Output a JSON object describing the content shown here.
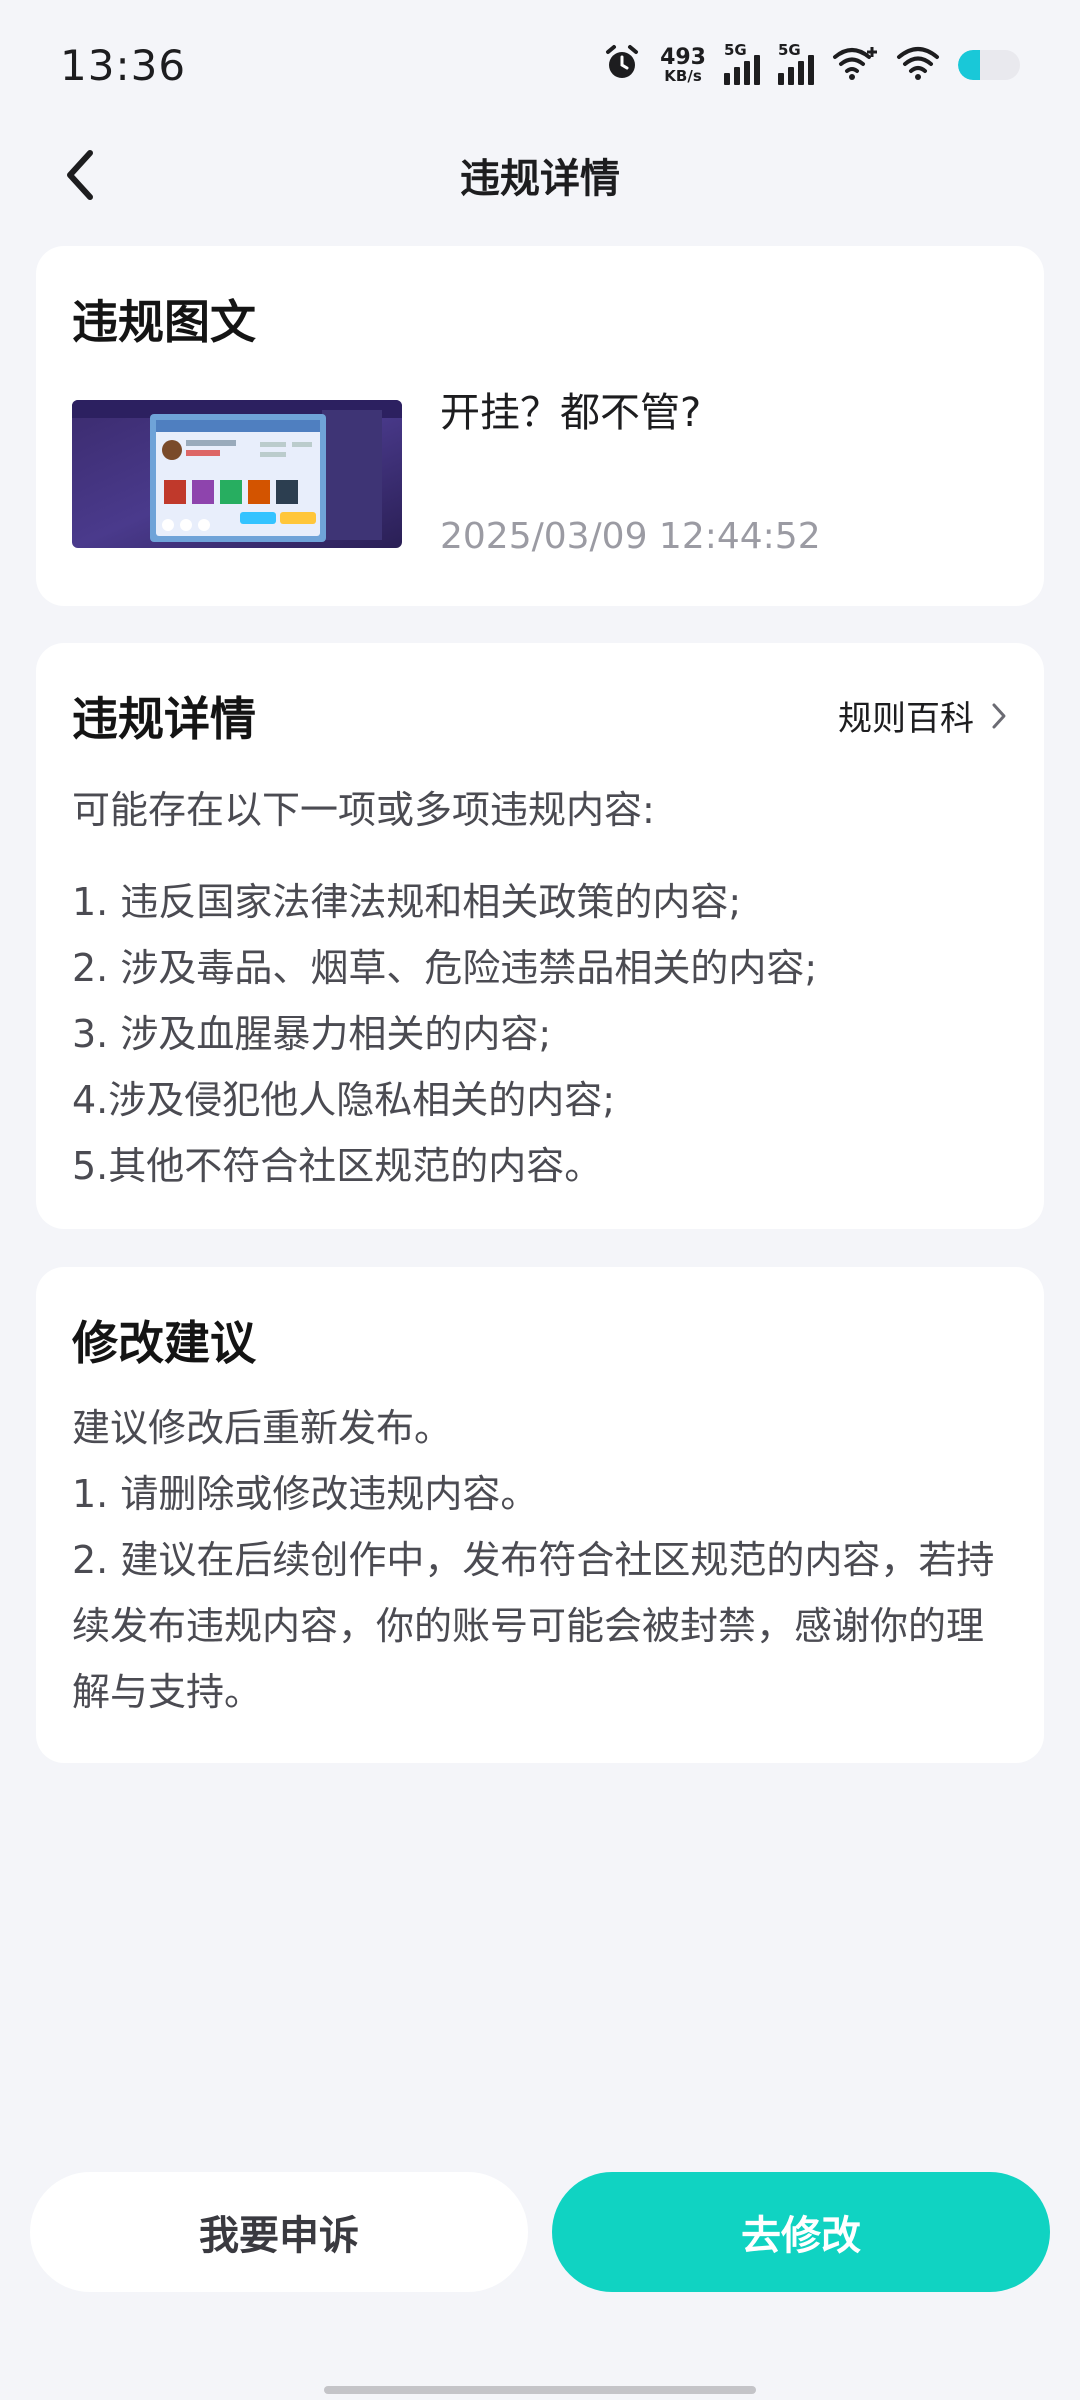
{
  "status_bar": {
    "time": "13:36",
    "net_speed_value": "493",
    "net_speed_unit": "KB/s",
    "signal1_label": "5G",
    "signal2_label": "5G",
    "icons": [
      "alarm-icon",
      "signal-icon",
      "wifi-plus-icon",
      "wifi-icon",
      "battery-icon"
    ],
    "battery_fill_fraction": 0.35,
    "battery_color": "#19c8d8"
  },
  "nav": {
    "title": "违规详情",
    "back_icon": "chevron-left-icon"
  },
  "violation_content": {
    "title": "违规图文",
    "post_text": "开挂？都不管?",
    "post_time": "2025/03/09 12:44:52"
  },
  "violation_details": {
    "title": "违规详情",
    "rules_link": "规则百科",
    "intro": "可能存在以下一项或多项违规内容:",
    "items": [
      "1. 违反国家法律法规和相关政策的内容;",
      "2. 涉及毒品、烟草、危险违禁品相关的内容;",
      "3. 涉及血腥暴力相关的内容;",
      "4.涉及侵犯他人隐私相关的内容;",
      "5.其他不符合社区规范的内容。"
    ]
  },
  "suggestions": {
    "title": "修改建议",
    "lines": [
      "建议修改后重新发布。",
      "1. 请删除或修改违规内容。",
      "2. 建议在后续创作中，发布符合社区规范的内容，若持续发布违规内容，你的账号可能会被封禁，感谢你的理解与支持。"
    ]
  },
  "actions": {
    "appeal_label": "我要申诉",
    "modify_label": "去修改",
    "accent_color": "#10d3c2"
  }
}
